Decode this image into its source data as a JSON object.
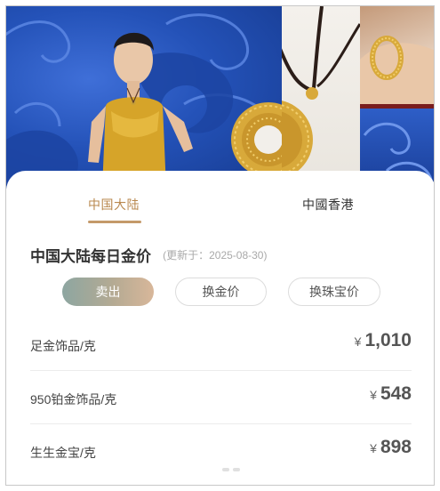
{
  "banner": {
    "colors": {
      "blue": "#2452b8",
      "gold": "#d8a93a",
      "cream": "#f2efea",
      "bronze": "#c49a7a"
    },
    "icons": [
      "model-photo",
      "pendant-necklace-photo",
      "bracelet-photo",
      "cloud-pattern-photo"
    ]
  },
  "tabs": [
    {
      "label": "中国大陆",
      "active": true
    },
    {
      "label": "中國香港",
      "active": false
    }
  ],
  "header": {
    "title": "中国大陆每日金价",
    "updated": "(更新于：2025-08-30)"
  },
  "filters": [
    {
      "label": "卖出",
      "active": true
    },
    {
      "label": "换金价",
      "active": false
    },
    {
      "label": "换珠宝价",
      "active": false
    }
  ],
  "prices": [
    {
      "name": "足金饰品/克",
      "currency": "¥",
      "amount": "1,010"
    },
    {
      "name": "950铂金饰品/克",
      "currency": "¥",
      "amount": "548"
    },
    {
      "name": "生生金宝/克",
      "currency": "¥",
      "amount": "898"
    }
  ],
  "accent": "#c49a6a"
}
